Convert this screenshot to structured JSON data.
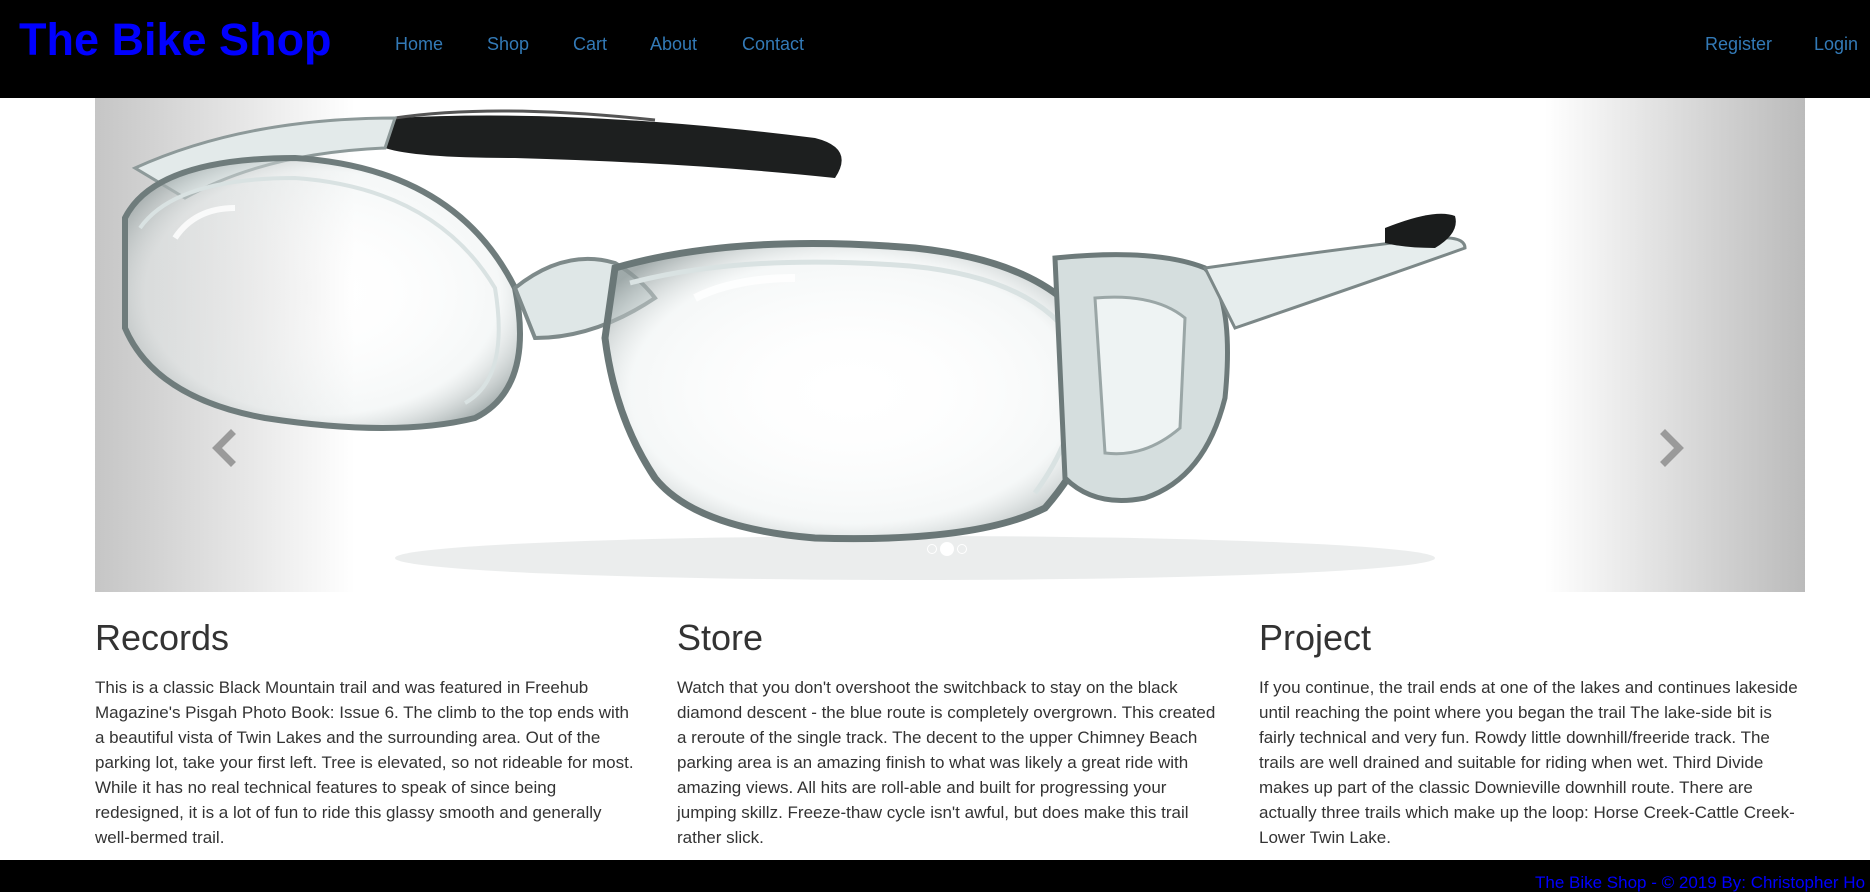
{
  "navbar": {
    "brand": "The Bike Shop",
    "links": [
      "Home",
      "Shop",
      "Cart",
      "About",
      "Contact"
    ],
    "right_links": [
      "Register",
      "Login"
    ],
    "link_color": "#337ab7",
    "brand_color": "#0000ff"
  },
  "carousel": {
    "slide_count": 3,
    "active_index": 1,
    "prev_icon": "chevron-left-icon",
    "next_icon": "chevron-right-icon"
  },
  "columns": [
    {
      "title": "Records",
      "text": "This is a classic Black Mountain trail and was featured in Freehub Magazine's Pisgah Photo Book: Issue 6. The climb to the top ends with a beautiful vista of Twin Lakes and the surrounding area. Out of the parking lot, take your first left. Tree is elevated, so not rideable for most. While it has no real technical features to speak of since being redesigned, it is a lot of fun to ride this glassy smooth and generally well-bermed trail."
    },
    {
      "title": "Store",
      "text": "Watch that you don't overshoot the switchback to stay on the black diamond descent - the blue route is completely overgrown. This created a reroute of the single track. The decent to the upper Chimney Beach parking area is an amazing finish to what was likely a great ride with amazing views. All hits are roll-able and built for progressing your jumping skillz. Freeze-thaw cycle isn't awful, but does make this trail rather slick."
    },
    {
      "title": "Project",
      "text": "If you continue, the trail ends at one of the lakes and continues lakeside until reaching the point where you began the trail The lake-side bit is fairly technical and very fun. Rowdy little downhill/freeride track. The trails are well drained and suitable for riding when wet. Third Divide makes up part of the classic Downieville downhill route. There are actually three trails which make up the loop: Horse Creek-Cattle Creek-Lower Twin Lake."
    }
  ],
  "footer": {
    "text": "The Bike Shop - © 2019 By: Christopher Ho"
  }
}
